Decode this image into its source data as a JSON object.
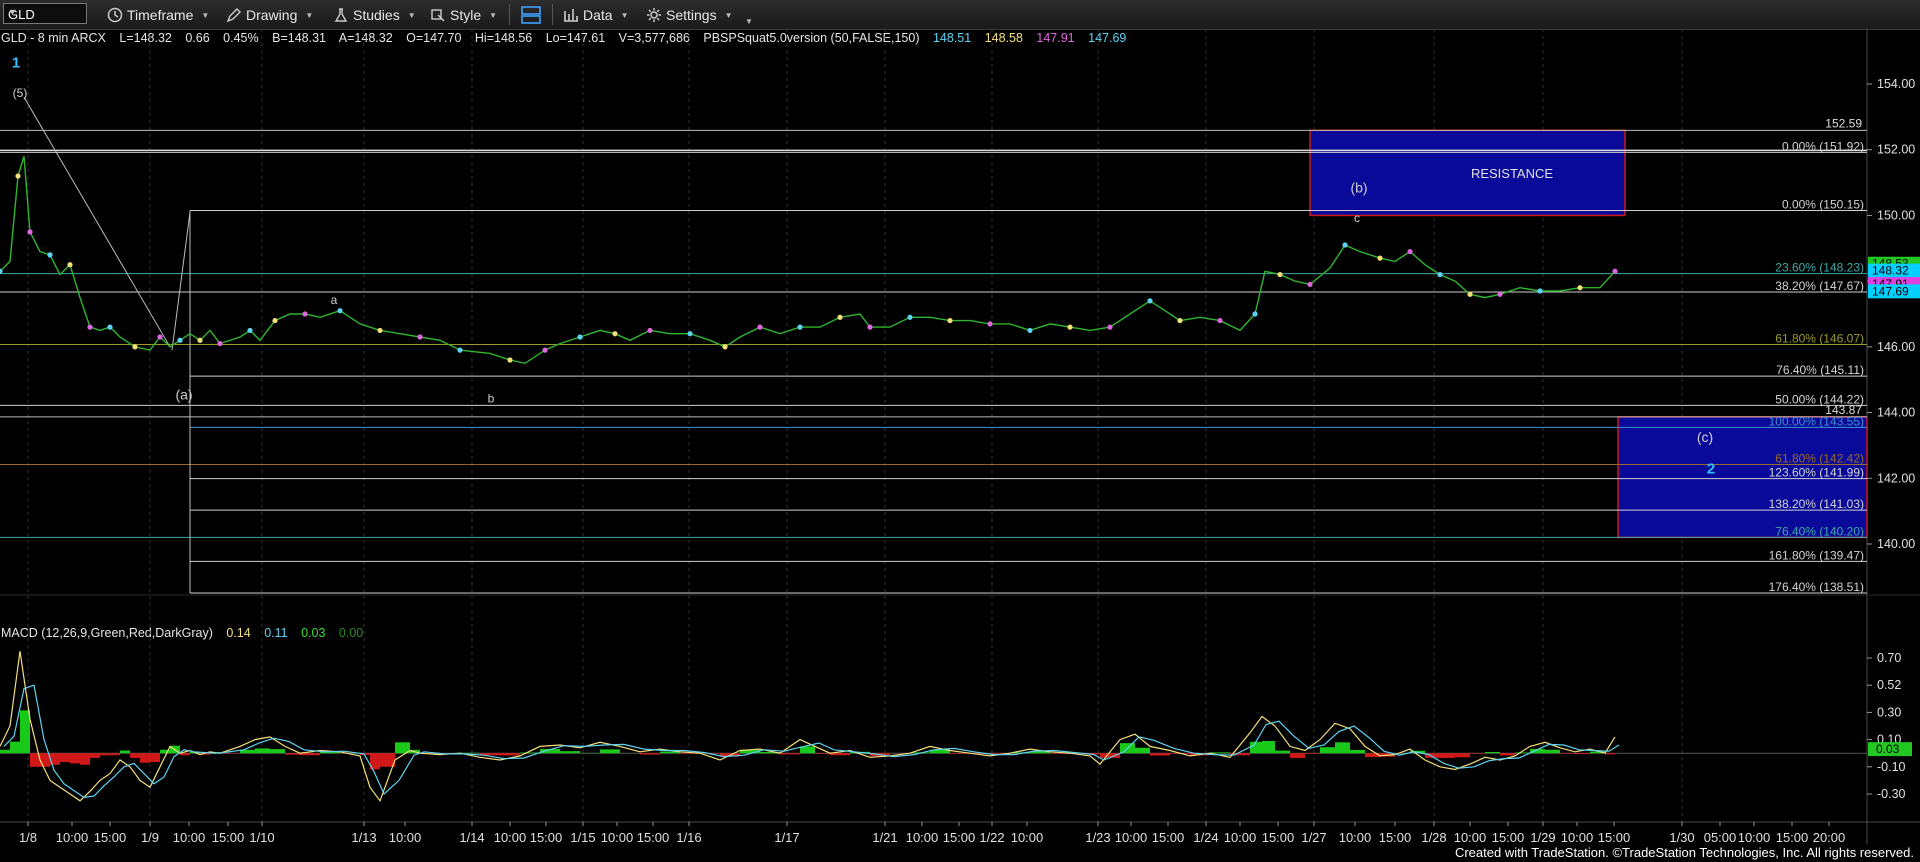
{
  "toolbar": {
    "symbol": "GLD",
    "timeframe_label": "Timeframe",
    "drawing_label": "Drawing",
    "studies_label": "Studies",
    "style_label": "Style",
    "data_label": "Data",
    "settings_label": "Settings"
  },
  "info": {
    "name": "GLD - 8 min  ARCX",
    "last": "L=148.32",
    "change": "0.66",
    "pct": "0.45%",
    "bid": "B=148.31",
    "ask": "A=148.32",
    "open": "O=147.70",
    "high": "Hi=148.56",
    "low": "Lo=147.61",
    "volume": "V=3,577,686",
    "study": "PBSPSquat5.0version (50,FALSE,150)",
    "study_vals": [
      "148.51",
      "148.58",
      "147.91",
      "147.69"
    ],
    "study_colors": [
      "#5fd3f3",
      "#f3e07a",
      "#e066e0",
      "#5fd3f3"
    ]
  },
  "macd_info": {
    "name": "MACD (12,26,9,Green,Red,DarkGray)",
    "vals": [
      "0.14",
      "0.11",
      "0.03",
      "0.00"
    ],
    "colors": [
      "#f3e07a",
      "#5fd3f3",
      "#33dd33",
      "#2a8a2a"
    ]
  },
  "footer": "Created with TradeStation. ©TradeStation Technologies, Inc. All rights reserved.",
  "chart_data": {
    "type": "line",
    "title": "GLD - 8 min",
    "price_axis": {
      "ticks": [
        154,
        152,
        150,
        148,
        146,
        144,
        142,
        140
      ],
      "tick_labels": [
        "154.00",
        "152.00",
        "150.00",
        "148.00",
        "146.00",
        "144.00",
        "142.00",
        "140.00"
      ],
      "ylim": [
        138,
        155.5
      ],
      "badges": [
        {
          "text": "148.53",
          "value": 148.53,
          "color": "#22c722"
        },
        {
          "text": "148.32",
          "value": 148.32,
          "color": "#00d0ff"
        },
        {
          "text": "147.91",
          "value": 147.91,
          "color": "#e040e0"
        },
        {
          "text": "147.69",
          "value": 147.69,
          "color": "#00d0ff"
        }
      ]
    },
    "macd_axis": {
      "ticks": [
        0.7,
        0.5,
        0.3,
        0.1,
        -0.1,
        -0.3
      ],
      "tick_labels": [
        "0.70",
        "0.52",
        "0.30",
        "0.10",
        "-0.10",
        "-0.30"
      ],
      "badge": "0.03",
      "ylim": [
        -0.42,
        0.82
      ]
    },
    "x_labels": [
      {
        "t": "1/8",
        "x": 28
      },
      {
        "t": "10:00",
        "x": 72
      },
      {
        "t": "15:00",
        "x": 110
      },
      {
        "t": "1/9",
        "x": 150
      },
      {
        "t": "10:00",
        "x": 189
      },
      {
        "t": "15:00",
        "x": 228
      },
      {
        "t": "1/10",
        "x": 262
      },
      {
        "t": "1/13",
        "x": 364
      },
      {
        "t": "10:00",
        "x": 405
      },
      {
        "t": "1/14",
        "x": 472
      },
      {
        "t": "10:00",
        "x": 510
      },
      {
        "t": "15:00",
        "x": 546
      },
      {
        "t": "1/15",
        "x": 583
      },
      {
        "t": "10:00",
        "x": 617
      },
      {
        "t": "15:00",
        "x": 653
      },
      {
        "t": "1/16",
        "x": 689
      },
      {
        "t": "1/17",
        "x": 787
      },
      {
        "t": "1/21",
        "x": 885
      },
      {
        "t": "10:00",
        "x": 922
      },
      {
        "t": "15:00",
        "x": 959
      },
      {
        "t": "1/22",
        "x": 992
      },
      {
        "t": "10:00",
        "x": 1027
      },
      {
        "t": "1/23",
        "x": 1098
      },
      {
        "t": "10:00",
        "x": 1131
      },
      {
        "t": "15:00",
        "x": 1168
      },
      {
        "t": "1/24",
        "x": 1206
      },
      {
        "t": "10:00",
        "x": 1240
      },
      {
        "t": "15:00",
        "x": 1278
      },
      {
        "t": "1/27",
        "x": 1314
      },
      {
        "t": "10:00",
        "x": 1355
      },
      {
        "t": "15:00",
        "x": 1395
      },
      {
        "t": "1/28",
        "x": 1434
      },
      {
        "t": "10:00",
        "x": 1470
      },
      {
        "t": "15:00",
        "x": 1508
      },
      {
        "t": "1/29",
        "x": 1543
      },
      {
        "t": "10:00",
        "x": 1577
      },
      {
        "t": "15:00",
        "x": 1614
      },
      {
        "t": "1/30",
        "x": 1682
      },
      {
        "t": "05:00",
        "x": 1720
      },
      {
        "t": "10:00",
        "x": 1754
      },
      {
        "t": "15:00",
        "x": 1792
      },
      {
        "t": "20:00",
        "x": 1829
      }
    ],
    "price_series": [
      [
        0,
        148.3
      ],
      [
        10,
        148.6
      ],
      [
        18,
        151.2
      ],
      [
        24,
        151.8
      ],
      [
        30,
        149.5
      ],
      [
        40,
        148.9
      ],
      [
        50,
        148.8
      ],
      [
        60,
        148.2
      ],
      [
        70,
        148.5
      ],
      [
        80,
        147.5
      ],
      [
        90,
        146.6
      ],
      [
        100,
        146.5
      ],
      [
        110,
        146.6
      ],
      [
        120,
        146.3
      ],
      [
        135,
        146.0
      ],
      [
        150,
        145.9
      ],
      [
        160,
        146.3
      ],
      [
        170,
        146.0
      ],
      [
        180,
        146.2
      ],
      [
        190,
        146.4
      ],
      [
        200,
        146.2
      ],
      [
        210,
        146.5
      ],
      [
        220,
        146.1
      ],
      [
        240,
        146.3
      ],
      [
        250,
        146.5
      ],
      [
        260,
        146.2
      ],
      [
        275,
        146.8
      ],
      [
        290,
        147.0
      ],
      [
        305,
        147.0
      ],
      [
        320,
        146.9
      ],
      [
        340,
        147.1
      ],
      [
        360,
        146.7
      ],
      [
        380,
        146.5
      ],
      [
        400,
        146.4
      ],
      [
        420,
        146.3
      ],
      [
        440,
        146.2
      ],
      [
        460,
        145.9
      ],
      [
        490,
        145.8
      ],
      [
        510,
        145.6
      ],
      [
        525,
        145.5
      ],
      [
        545,
        145.9
      ],
      [
        560,
        146.1
      ],
      [
        580,
        146.3
      ],
      [
        600,
        146.5
      ],
      [
        615,
        146.4
      ],
      [
        630,
        146.2
      ],
      [
        650,
        146.5
      ],
      [
        670,
        146.4
      ],
      [
        690,
        146.4
      ],
      [
        710,
        146.2
      ],
      [
        725,
        146.0
      ],
      [
        740,
        146.3
      ],
      [
        760,
        146.6
      ],
      [
        780,
        146.4
      ],
      [
        800,
        146.6
      ],
      [
        820,
        146.6
      ],
      [
        840,
        146.9
      ],
      [
        860,
        147.0
      ],
      [
        870,
        146.6
      ],
      [
        890,
        146.6
      ],
      [
        910,
        146.9
      ],
      [
        930,
        146.9
      ],
      [
        950,
        146.8
      ],
      [
        970,
        146.8
      ],
      [
        990,
        146.7
      ],
      [
        1010,
        146.7
      ],
      [
        1030,
        146.5
      ],
      [
        1050,
        146.7
      ],
      [
        1070,
        146.6
      ],
      [
        1090,
        146.5
      ],
      [
        1110,
        146.6
      ],
      [
        1130,
        147.0
      ],
      [
        1150,
        147.4
      ],
      [
        1165,
        147.1
      ],
      [
        1180,
        146.8
      ],
      [
        1200,
        146.9
      ],
      [
        1220,
        146.8
      ],
      [
        1240,
        146.5
      ],
      [
        1255,
        147.0
      ],
      [
        1265,
        148.3
      ],
      [
        1280,
        148.2
      ],
      [
        1295,
        148.0
      ],
      [
        1310,
        147.9
      ],
      [
        1330,
        148.4
      ],
      [
        1345,
        149.1
      ],
      [
        1360,
        148.9
      ],
      [
        1380,
        148.7
      ],
      [
        1395,
        148.6
      ],
      [
        1410,
        148.9
      ],
      [
        1425,
        148.5
      ],
      [
        1440,
        148.2
      ],
      [
        1455,
        148.0
      ],
      [
        1470,
        147.6
      ],
      [
        1485,
        147.5
      ],
      [
        1500,
        147.6
      ],
      [
        1520,
        147.8
      ],
      [
        1540,
        147.7
      ],
      [
        1560,
        147.7
      ],
      [
        1580,
        147.8
      ],
      [
        1600,
        147.8
      ],
      [
        1615,
        148.3
      ]
    ],
    "macd_series": [
      [
        0,
        0.05
      ],
      [
        10,
        0.2
      ],
      [
        20,
        0.75
      ],
      [
        30,
        0.25
      ],
      [
        40,
        -0.05
      ],
      [
        50,
        -0.2
      ],
      [
        60,
        -0.25
      ],
      [
        70,
        -0.3
      ],
      [
        80,
        -0.35
      ],
      [
        90,
        -0.28
      ],
      [
        100,
        -0.2
      ],
      [
        110,
        -0.15
      ],
      [
        120,
        -0.05
      ],
      [
        130,
        -0.1
      ],
      [
        140,
        -0.2
      ],
      [
        150,
        -0.25
      ],
      [
        160,
        -0.1
      ],
      [
        170,
        0.05
      ],
      [
        180,
        0.0
      ],
      [
        190,
        0.02
      ],
      [
        200,
        -0.01
      ],
      [
        210,
        0.01
      ],
      [
        220,
        0.0
      ],
      [
        240,
        0.05
      ],
      [
        255,
        0.1
      ],
      [
        270,
        0.12
      ],
      [
        285,
        0.05
      ],
      [
        300,
        0.0
      ],
      [
        320,
        0.02
      ],
      [
        340,
        0.01
      ],
      [
        360,
        -0.02
      ],
      [
        370,
        -0.25
      ],
      [
        380,
        -0.35
      ],
      [
        395,
        -0.05
      ],
      [
        410,
        0.02
      ],
      [
        420,
        0.0
      ],
      [
        440,
        -0.01
      ],
      [
        460,
        0.0
      ],
      [
        480,
        -0.03
      ],
      [
        500,
        -0.05
      ],
      [
        520,
        -0.02
      ],
      [
        540,
        0.05
      ],
      [
        560,
        0.06
      ],
      [
        580,
        0.04
      ],
      [
        600,
        0.08
      ],
      [
        620,
        0.05
      ],
      [
        640,
        0.01
      ],
      [
        660,
        0.03
      ],
      [
        680,
        0.01
      ],
      [
        700,
        0.0
      ],
      [
        720,
        -0.05
      ],
      [
        740,
        0.02
      ],
      [
        760,
        0.03
      ],
      [
        780,
        0.0
      ],
      [
        800,
        0.1
      ],
      [
        815,
        0.05
      ],
      [
        830,
        0.0
      ],
      [
        850,
        0.02
      ],
      [
        870,
        -0.03
      ],
      [
        890,
        -0.02
      ],
      [
        910,
        0.0
      ],
      [
        930,
        0.05
      ],
      [
        950,
        0.02
      ],
      [
        970,
        0.0
      ],
      [
        990,
        -0.02
      ],
      [
        1010,
        0.0
      ],
      [
        1030,
        0.03
      ],
      [
        1050,
        0.01
      ],
      [
        1070,
        0.0
      ],
      [
        1090,
        -0.02
      ],
      [
        1100,
        -0.08
      ],
      [
        1120,
        0.1
      ],
      [
        1135,
        0.14
      ],
      [
        1150,
        0.05
      ],
      [
        1170,
        0.02
      ],
      [
        1190,
        -0.02
      ],
      [
        1210,
        0.0
      ],
      [
        1230,
        -0.03
      ],
      [
        1250,
        0.15
      ],
      [
        1262,
        0.27
      ],
      [
        1275,
        0.2
      ],
      [
        1290,
        0.05
      ],
      [
        1305,
        0.02
      ],
      [
        1320,
        0.1
      ],
      [
        1335,
        0.22
      ],
      [
        1350,
        0.18
      ],
      [
        1365,
        0.05
      ],
      [
        1380,
        -0.02
      ],
      [
        1395,
        -0.01
      ],
      [
        1410,
        0.03
      ],
      [
        1425,
        -0.05
      ],
      [
        1440,
        -0.1
      ],
      [
        1455,
        -0.12
      ],
      [
        1470,
        -0.08
      ],
      [
        1485,
        -0.03
      ],
      [
        1500,
        -0.05
      ],
      [
        1515,
        -0.02
      ],
      [
        1530,
        0.05
      ],
      [
        1545,
        0.08
      ],
      [
        1560,
        0.04
      ],
      [
        1575,
        0.01
      ],
      [
        1590,
        0.03
      ],
      [
        1605,
        0.0
      ],
      [
        1615,
        0.12
      ]
    ],
    "fib_lines": [
      {
        "label": "0.00% (151.92)",
        "value": 151.92,
        "x0": 0,
        "color": "#cfcfcf"
      },
      {
        "label": "0.00% (150.15)",
        "value": 150.15,
        "x0": 190,
        "color": "#cfcfcf"
      },
      {
        "label": "23.60% (148.23)",
        "value": 148.23,
        "x0": 0,
        "color": "#3fa7a7"
      },
      {
        "label": "38.20% (147.67)",
        "value": 147.67,
        "x0": 0,
        "color": "#cfcfcf"
      },
      {
        "label": "61.80% (146.07)",
        "value": 146.07,
        "x0": 0,
        "color": "#9a9a2a"
      },
      {
        "label": "76.40% (145.11)",
        "value": 145.11,
        "x0": 190,
        "color": "#cfcfcf"
      },
      {
        "label": "50.00% (144.22)",
        "value": 144.22,
        "x0": 0,
        "color": "#cfcfcf"
      },
      {
        "label": "100.00% (143.55)",
        "value": 143.55,
        "x0": 190,
        "color": "#3f8fd0"
      },
      {
        "label": "61.80% (142.42)",
        "value": 142.42,
        "x0": 0,
        "color": "#9a6a2a"
      },
      {
        "label": "123.60% (141.99)",
        "value": 141.99,
        "x0": 190,
        "color": "#cfcfcf"
      },
      {
        "label": "138.20% (141.03)",
        "value": 141.03,
        "x0": 190,
        "color": "#cfcfcf"
      },
      {
        "label": "76.40% (140.20)",
        "value": 140.2,
        "x0": 0,
        "color": "#3fa7a7"
      },
      {
        "label": "161.80% (139.47)",
        "value": 139.47,
        "x0": 190,
        "color": "#cfcfcf"
      },
      {
        "label": "176.40% (138.51)",
        "value": 138.51,
        "x0": 190,
        "color": "#cfcfcf"
      }
    ],
    "level_lines": [
      {
        "label": "152.59",
        "value": 152.59
      },
      {
        "label": "143.87",
        "value": 143.87
      }
    ],
    "resistance_zone": {
      "label": "RESISTANCE",
      "top": 152.59,
      "bottom": 150.0
    },
    "target_zone": {
      "top": 143.87,
      "bottom": 140.2
    },
    "wave_labels": [
      {
        "t": "1",
        "x": 16,
        "value": 154.5,
        "color": "#30c0ff",
        "size": 15
      },
      {
        "t": "(5)",
        "x": 20,
        "value": 153.6,
        "color": "#cfcfcf",
        "size": 12
      },
      {
        "t": "(a)",
        "x": 184,
        "value": 144.4,
        "color": "#cfcfcf",
        "size": 14
      },
      {
        "t": "a",
        "x": 334,
        "value": 147.3,
        "color": "#cfcfcf",
        "size": 12
      },
      {
        "t": "b",
        "x": 491,
        "value": 144.3,
        "color": "#cfcfcf",
        "size": 12
      },
      {
        "t": "(b)",
        "x": 1359,
        "value": 150.7,
        "color": "#cfcfcf",
        "size": 14
      },
      {
        "t": "c",
        "x": 1357,
        "value": 149.8,
        "color": "#cfcfcf",
        "size": 12
      },
      {
        "t": "(c)",
        "x": 1705,
        "value": 143.1,
        "color": "#cfcfcf",
        "size": 14
      },
      {
        "t": "2",
        "x": 1711,
        "value": 142.15,
        "color": "#30c0ff",
        "size": 15
      }
    ]
  }
}
